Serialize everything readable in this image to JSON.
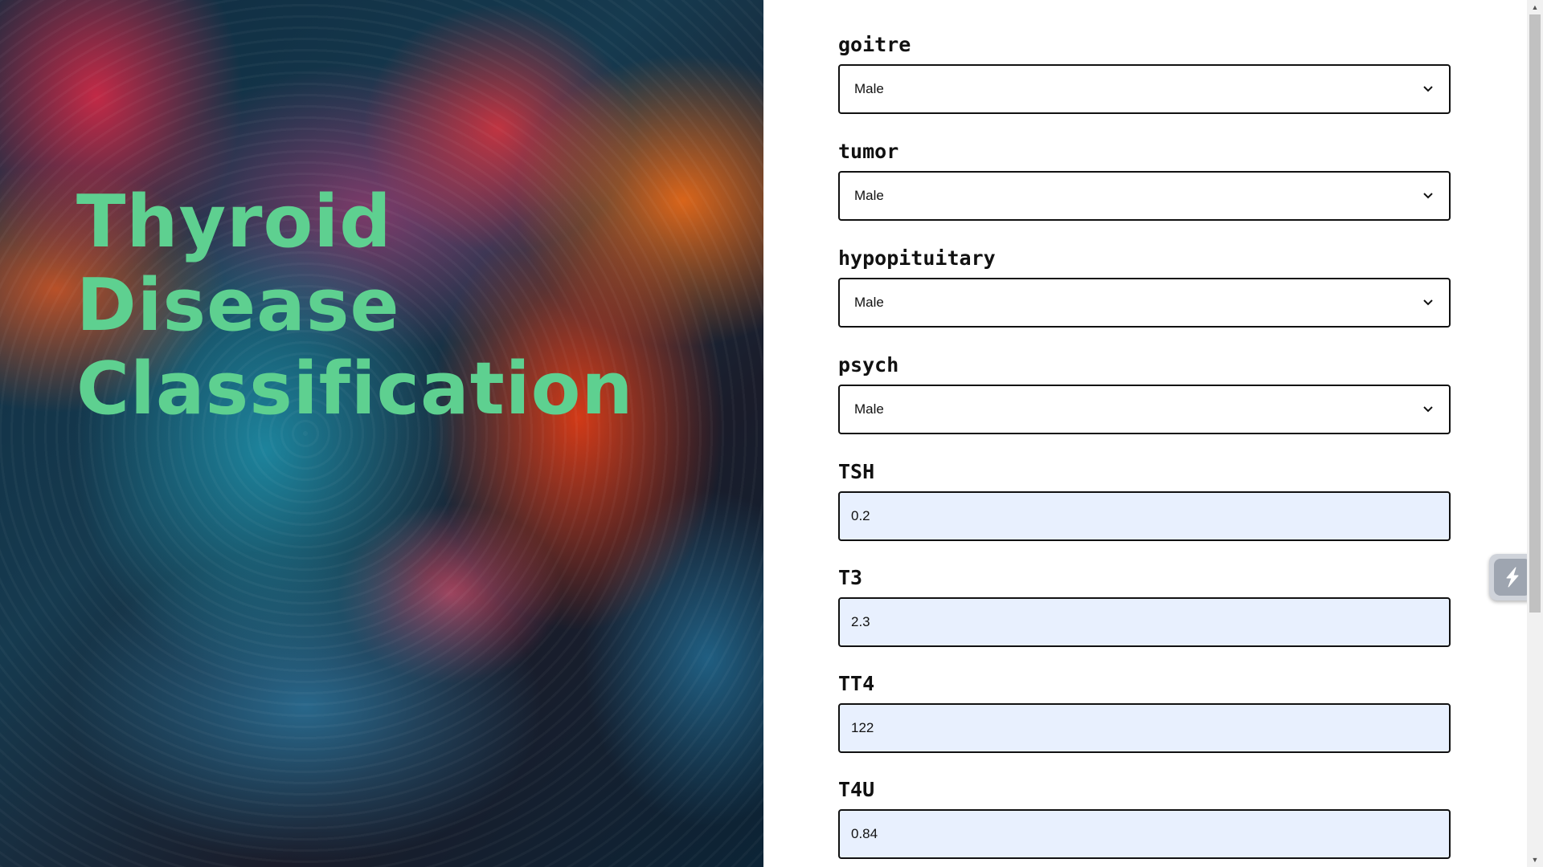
{
  "hero": {
    "title_lines": [
      "Thyroid",
      "Disease",
      "Classification"
    ],
    "title_color": "#5ed090"
  },
  "form": {
    "fields": [
      {
        "label": "goitre",
        "type": "select",
        "value": "Male"
      },
      {
        "label": "tumor",
        "type": "select",
        "value": "Male"
      },
      {
        "label": "hypopituitary",
        "type": "select",
        "value": "Male"
      },
      {
        "label": "psych",
        "type": "select",
        "value": "Male"
      },
      {
        "label": "TSH",
        "type": "input",
        "value": "0.2"
      },
      {
        "label": "T3",
        "type": "input",
        "value": "2.3"
      },
      {
        "label": "TT4",
        "type": "input",
        "value": "122"
      },
      {
        "label": "T4U",
        "type": "input",
        "value": "0.84"
      }
    ],
    "input_fill_color": "#e8f0fe"
  },
  "widget": {
    "icon": "lightning-icon"
  }
}
